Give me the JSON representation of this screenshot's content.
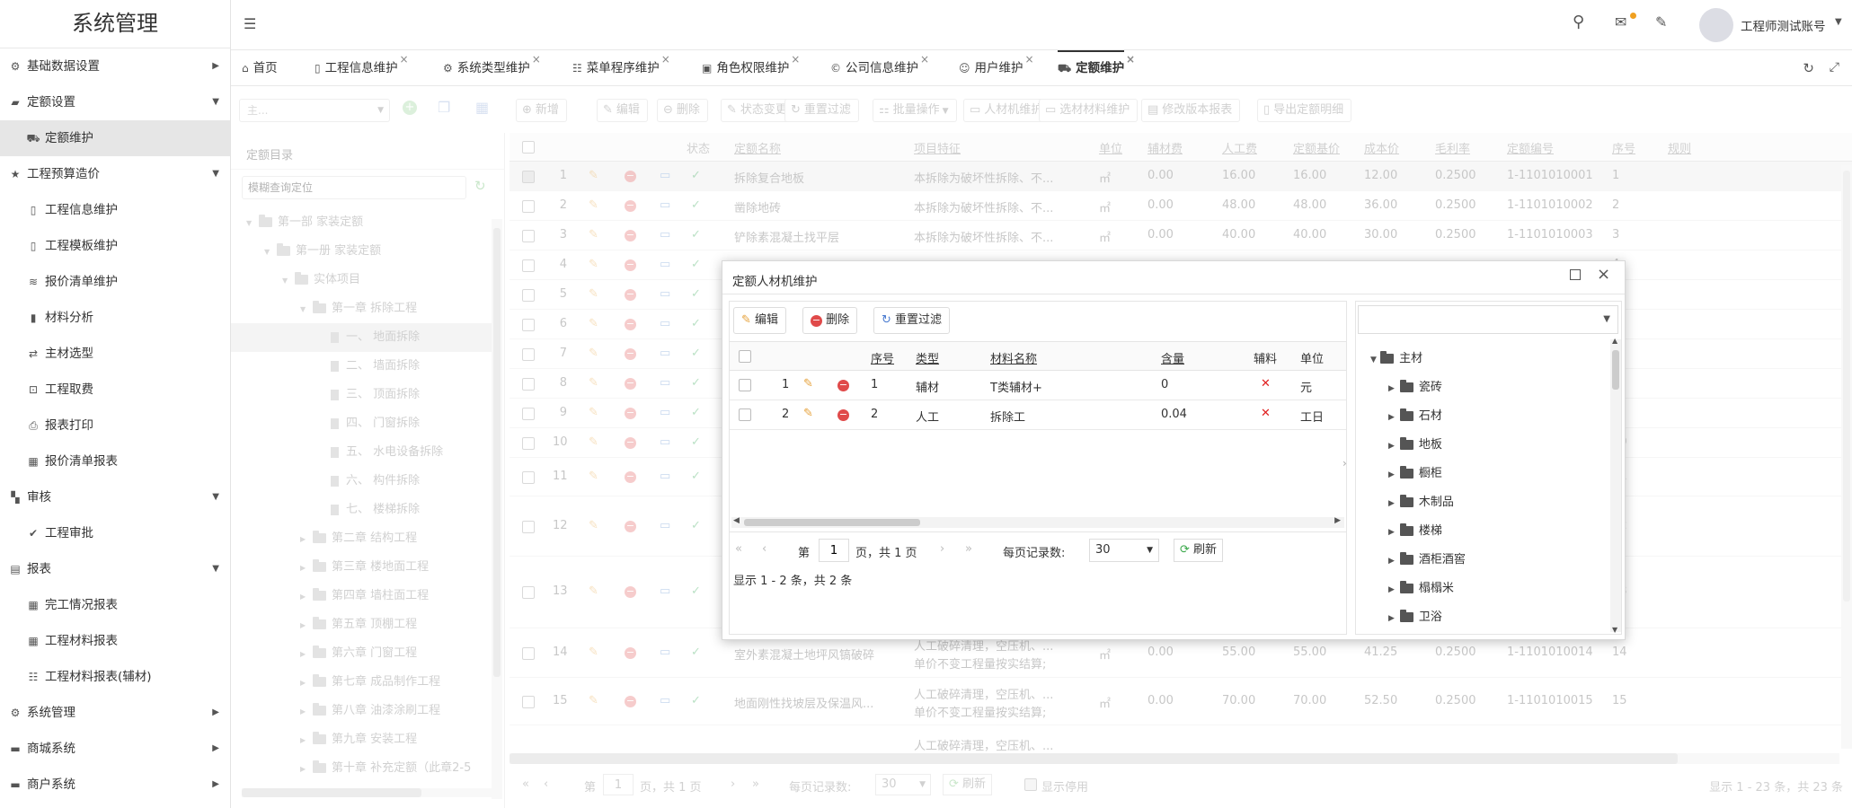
{
  "app": {
    "title": "系统管理",
    "user_name": "工程师测试账号"
  },
  "sidebar": {
    "items": [
      {
        "label": "基础数据设置",
        "icon": "gear-icon",
        "level": 0,
        "arrow": "▶"
      },
      {
        "label": "定额设置",
        "icon": "briefcase-icon",
        "level": 0,
        "arrow": "▼"
      },
      {
        "label": "定额维护",
        "icon": "cart-icon",
        "level": 1,
        "active": true
      },
      {
        "label": "工程预算造价",
        "icon": "star-icon",
        "level": 0,
        "arrow": "▼"
      },
      {
        "label": "工程信息维护",
        "icon": "document-icon",
        "level": 1
      },
      {
        "label": "工程模板维护",
        "icon": "document-icon",
        "level": 1
      },
      {
        "label": "报价清单维护",
        "icon": "database-icon",
        "level": 1
      },
      {
        "label": "材料分析",
        "icon": "phone-icon",
        "level": 1
      },
      {
        "label": "主材选型",
        "icon": "exchange-icon",
        "level": 1
      },
      {
        "label": "工程取费",
        "icon": "money-icon",
        "level": 1
      },
      {
        "label": "报表打印",
        "icon": "print-icon",
        "level": 1
      },
      {
        "label": "报价清单报表",
        "icon": "table-icon",
        "level": 1
      },
      {
        "label": "审核",
        "icon": "grid-icon",
        "level": 0,
        "arrow": "▼"
      },
      {
        "label": "工程审批",
        "icon": "check-icon",
        "level": 1
      },
      {
        "label": "报表",
        "icon": "report-icon",
        "level": 0,
        "arrow": "▼"
      },
      {
        "label": "完工情况报表",
        "icon": "table-icon",
        "level": 1
      },
      {
        "label": "工程材料报表",
        "icon": "table-icon",
        "level": 1
      },
      {
        "label": "工程材料报表(辅材)",
        "icon": "list-icon",
        "level": 1
      },
      {
        "label": "系统管理",
        "icon": "gear-icon",
        "level": 0,
        "arrow": "▶"
      },
      {
        "label": "商城系统",
        "icon": "folder-icon",
        "level": 0,
        "arrow": "▶"
      },
      {
        "label": "商户系统",
        "icon": "folder-icon",
        "level": 0,
        "arrow": "▶"
      }
    ]
  },
  "tabs": [
    {
      "label": "首页",
      "icon": "home-icon"
    },
    {
      "label": "工程信息维护",
      "icon": "document-icon"
    },
    {
      "label": "系统类型维护",
      "icon": "gears-icon"
    },
    {
      "label": "菜单程序维护",
      "icon": "list-icon"
    },
    {
      "label": "角色权限维护",
      "icon": "box-icon"
    },
    {
      "label": "公司信息维护",
      "icon": "copyright-icon"
    },
    {
      "label": "用户维护",
      "icon": "user-icon"
    },
    {
      "label": "定额维护",
      "icon": "cart-icon",
      "active": true
    }
  ],
  "toolbar": {
    "version_select": "主...",
    "buttons": [
      "新增",
      "编辑",
      "删除",
      "状态变更",
      "重置过滤",
      "批量操作",
      "人材机维护",
      "选材材料维护",
      "修改版本报表",
      "导出定额明细"
    ]
  },
  "tree_panel": {
    "title": "定额目录",
    "search_placeholder": "模糊查询定位",
    "nodes": [
      "第一部 家装定额",
      "第一册 家装定额",
      "实体项目",
      "第一章 拆除工程",
      "一、 地面拆除",
      "二、 墙面拆除",
      "三、 顶面拆除",
      "四、 门窗拆除",
      "五、 水电设备拆除",
      "六、 构件拆除",
      "七、 楼梯拆除",
      "第二章 结构工程",
      "第三章 楼地面工程",
      "第四章 墙柱面工程",
      "第五章 顶棚工程",
      "第六章 门窗工程",
      "第七章 成品制作工程",
      "第八章 油漆涂刷工程",
      "第九章 安装工程",
      "第十章 补充定额（此章2-5"
    ]
  },
  "grid": {
    "columns": [
      "状态",
      "定额名称",
      "项目特征",
      "单位",
      "辅材费",
      "人工费",
      "定额基价",
      "成本价",
      "毛利率",
      "定额编号",
      "序号",
      "规则"
    ],
    "rows": [
      {
        "n": "1",
        "name": "拆除复合地板",
        "feat": "本拆除为破坏性拆除、不...",
        "unit": "㎡",
        "fc": "0.00",
        "rg": "16.00",
        "jj": "16.00",
        "cb": "12.00",
        "ml": "0.2500",
        "code": "1-1101010001",
        "seq": "1"
      },
      {
        "n": "2",
        "name": "凿除地砖",
        "feat": "本拆除为破坏性拆除、不...",
        "unit": "㎡",
        "fc": "0.00",
        "rg": "48.00",
        "jj": "48.00",
        "cb": "36.00",
        "ml": "0.2500",
        "code": "1-1101010002",
        "seq": "2"
      },
      {
        "n": "3",
        "name": "铲除素混凝土找平层",
        "feat": "本拆除为破坏性拆除、不...",
        "unit": "㎡",
        "fc": "0.00",
        "rg": "40.00",
        "jj": "40.00",
        "cb": "30.00",
        "ml": "0.2500",
        "code": "1-1101010003",
        "seq": "3"
      },
      {
        "n": "4",
        "seq": "4"
      },
      {
        "n": "5",
        "seq": "5"
      },
      {
        "n": "6",
        "seq": "6"
      },
      {
        "n": "7",
        "seq": "7"
      },
      {
        "n": "8",
        "seq": "8"
      },
      {
        "n": "9",
        "seq": "9"
      },
      {
        "n": "10",
        "seq": "10"
      },
      {
        "n": "11",
        "seq": "11"
      },
      {
        "n": "12",
        "seq": "12"
      },
      {
        "n": "13",
        "seq": "13"
      },
      {
        "n": "14",
        "name": "室外素混凝土地坪风镐破碎",
        "feat": "人工破碎清理，空压机、...",
        "feat2": "单价不变工程量按实结算;",
        "unit": "㎡",
        "fc": "0.00",
        "rg": "55.00",
        "jj": "55.00",
        "cb": "41.25",
        "ml": "0.2500",
        "code": "1-1101010014",
        "seq": "14"
      },
      {
        "n": "15",
        "name": "地面刚性找坡层及保温风...",
        "feat": "人工破碎清理，空压机、...",
        "feat2": "单价不变工程量按实结算;",
        "unit": "㎡",
        "fc": "0.00",
        "rg": "70.00",
        "jj": "70.00",
        "cb": "52.50",
        "ml": "0.2500",
        "code": "1-1101010015",
        "seq": "15"
      }
    ],
    "partial_row": "人工破碎清理，空压机、..."
  },
  "pager": {
    "prefix": "第",
    "page": "1",
    "suffix": "页，共 1 页",
    "size_label": "每页记录数:",
    "size": "30",
    "refresh": "刷新",
    "show_disabled": "显示停用",
    "summary": "显示 1 - 23 条，共 23 条"
  },
  "dialog": {
    "title": "定额人材机维护",
    "buttons": {
      "edit": "编辑",
      "delete": "删除",
      "reset": "重置过滤"
    },
    "columns": [
      "序号",
      "类型",
      "材料名称",
      "含量",
      "辅料",
      "单位"
    ],
    "rows": [
      {
        "n": "1",
        "seq": "1",
        "type": "辅材",
        "name": "T类辅材+",
        "qty": "0",
        "unit": "元"
      },
      {
        "n": "2",
        "seq": "2",
        "type": "人工",
        "name": "拆除工",
        "qty": "0.04",
        "unit": "工日"
      }
    ],
    "pager": {
      "prefix": "第",
      "page": "1",
      "suffix": "页，共 1 页",
      "size_label": "每页记录数:",
      "size": "30",
      "refresh": "刷新",
      "summary": "显示 1 - 2 条，共 2 条"
    },
    "tree": {
      "root": "主材",
      "children": [
        "瓷砖",
        "石材",
        "地板",
        "橱柜",
        "木制品",
        "楼梯",
        "酒柜酒窖",
        "榻榻米",
        "卫浴"
      ]
    }
  }
}
